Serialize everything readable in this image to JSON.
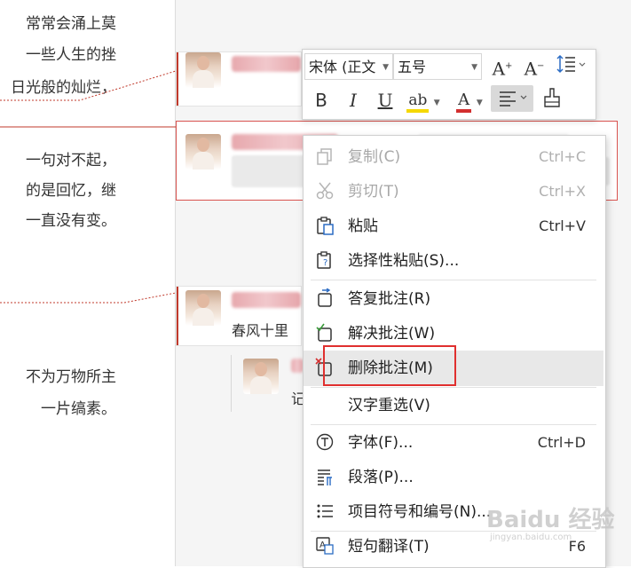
{
  "document": {
    "lines": [
      "常常会涌上莫",
      "一些人生的挫",
      "日光般的灿烂，",
      "一句对不起，",
      "的是回忆，继",
      "一直没有变。",
      "不为万物所主",
      "一片缟素。"
    ]
  },
  "comments": {
    "third_comment_text": "春风十里",
    "reply_text": "记"
  },
  "toolbar": {
    "font_name": "宋体 (正文",
    "font_size": "五号",
    "grow_font": "A",
    "shrink_font": "A",
    "bold": "B",
    "italic": "I",
    "underline": "U",
    "highlight": "ab",
    "font_color": "A"
  },
  "context_menu": {
    "items": [
      {
        "label": "复制(C)",
        "shortcut": "Ctrl+C",
        "icon": "copy-icon",
        "disabled": true
      },
      {
        "label": "剪切(T)",
        "shortcut": "Ctrl+X",
        "icon": "scissors-icon",
        "disabled": true
      },
      {
        "label": "粘贴",
        "shortcut": "Ctrl+V",
        "icon": "paste-icon",
        "disabled": false
      },
      {
        "label": "选择性粘贴(S)...",
        "shortcut": "",
        "icon": "paste-special-icon",
        "disabled": false
      },
      {
        "label": "答复批注(R)",
        "shortcut": "",
        "icon": "reply-comment-icon",
        "disabled": false
      },
      {
        "label": "解决批注(W)",
        "shortcut": "",
        "icon": "resolve-comment-icon",
        "disabled": false
      },
      {
        "label": "删除批注(M)",
        "shortcut": "",
        "icon": "delete-comment-icon",
        "disabled": false
      },
      {
        "label": "汉字重选(V)",
        "shortcut": "",
        "icon": "",
        "disabled": false
      },
      {
        "label": "字体(F)...",
        "shortcut": "Ctrl+D",
        "icon": "font-icon",
        "disabled": false
      },
      {
        "label": "段落(P)...",
        "shortcut": "",
        "icon": "paragraph-icon",
        "disabled": false
      },
      {
        "label": "项目符号和编号(N)...",
        "shortcut": "",
        "icon": "bullet-list-icon",
        "disabled": false
      },
      {
        "label": "短句翻译(T)",
        "shortcut": "F6",
        "icon": "translate-icon",
        "disabled": false
      }
    ]
  },
  "watermark": {
    "brand": "Baidu 经验",
    "url": "jingyan.baidu.com"
  },
  "colors": {
    "accent_red": "#d9534f",
    "highlight_box": "#e0302f",
    "menu_hover": "#e8e8e8",
    "link_blue": "#2b6cc4"
  }
}
